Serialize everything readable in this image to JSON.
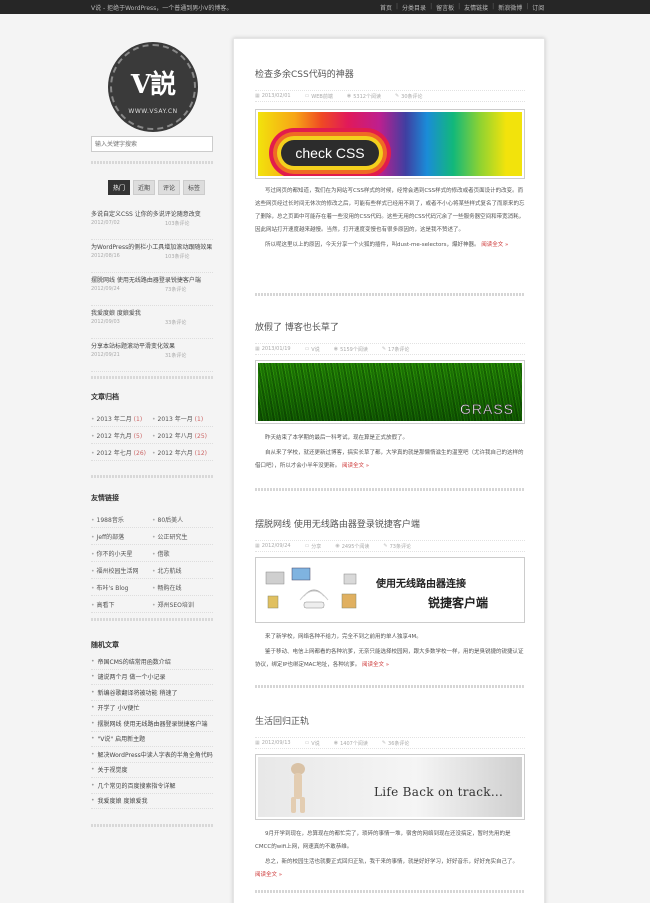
{
  "topbar": {
    "tagline": "V说 - 拒绝于WordPress，一个普通到男小V的博客。",
    "nav": [
      "首页",
      "分类目录",
      "留言板",
      "友情链接",
      "新浪微博",
      "订阅"
    ]
  },
  "logo": {
    "mark": "V説",
    "url": "WWW.VSAY.CN"
  },
  "search": {
    "placeholder": "输入关键字搜索"
  },
  "tabs": [
    "热门",
    "近期",
    "评论",
    "标签"
  ],
  "hot": [
    {
      "title": "多说自定义CSS 让你的多说评论随意改变",
      "date": "2012/07/02",
      "comments": "103条评论"
    },
    {
      "title": "为WordPress的侧栏小工具增加滚动跟随效果",
      "date": "2012/08/16",
      "comments": "103条评论"
    },
    {
      "title": "摆脱网线 使用无线路由器登录锐捷客户端",
      "date": "2012/09/24",
      "comments": "73条评论"
    },
    {
      "title": "我爱度娘 度娘爱我",
      "date": "2012/09/03",
      "comments": "33条评论"
    },
    {
      "title": "分享本站标题滚动平滑变化效果",
      "date": "2012/09/21",
      "comments": "31条评论"
    }
  ],
  "archive": {
    "title": "文章归档",
    "rows": [
      [
        {
          "label": "2013 年二月",
          "count": "(1)"
        },
        {
          "label": "2013 年一月",
          "count": "(1)"
        }
      ],
      [
        {
          "label": "2012 年九月",
          "count": "(5)"
        },
        {
          "label": "2012 年八月",
          "count": "(25)"
        }
      ],
      [
        {
          "label": "2012 年七月",
          "count": "(26)"
        },
        {
          "label": "2012 年六月",
          "count": "(12)"
        }
      ]
    ]
  },
  "links": {
    "title": "友情链接",
    "rows": [
      [
        "1988音乐",
        "80后美人"
      ],
      [
        "Jeff的部落",
        "公正研究生"
      ],
      [
        "你不的小天星",
        "借歌"
      ],
      [
        "福州校园生活网",
        "北方航线"
      ],
      [
        "布咔's Blog",
        "畅购在线"
      ],
      [
        "高看下",
        "郑州SEO培训"
      ]
    ]
  },
  "random": {
    "title": "随机文章",
    "items": [
      "帝国CMS的结常用函数介绍",
      "谴说两个月 做一个小记录",
      "新编谷歌翻译将被功能 稍速了",
      "开学了 小V便忙",
      "摆脱网线 使用无线路由器登录锐捷客户端",
      "\"V说\" 启用新主题",
      "解决WordPress中读人字表的半角全角代码",
      "关于视觉度",
      "几个常见的百度搜索指令详解",
      "我爱度娘 度娘爱我"
    ]
  },
  "posts": [
    {
      "title": "检查多余CSS代码的神器",
      "date": "2013/02/01",
      "category": "WEB前端",
      "views": "5312个阅读",
      "comments": "30条评论",
      "banner_text": "check CSS",
      "paragraphs": [
        "写过网页的都知道，我们在为网站写CSS样式的时候，经常会遇到CSS样式的修改或者页面设计的改变。而这些网页经过长时间无休次的修改之后，可能有些样式已经用不到了，或者不小心将某些样式复名了而原来的忘了删除，总之页面中可能存在着一些没用的CSS代码。这些无用的CSS代码冗余了一些服务器空间和带宽消耗，因此网站打开速度越来越慢。当然，打开速度变慢也有很多原因的，这是我不赞述了。",
        "所以呢这里以上的原因，今天分享一个火狐的插件，叫dust-me-selectors，爆好神器。"
      ],
      "more": "阅读全文 »"
    },
    {
      "title": "放假了 博客也长草了",
      "date": "2013/01/19",
      "category": "V说",
      "views": "5159个阅读",
      "comments": "17条评论",
      "banner_text": "GRASS",
      "paragraphs": [
        "昨天结束了本学期的最后一科考试，现在算是正式放假了。",
        "自从来了学校，就还更新过博客，搞实长草了都，大学真的就是那懒惰滋生的温室吧（尤许我自己的这样的借口吧），所以才会小半年没更新。"
      ],
      "more": "阅读全文 »"
    },
    {
      "title": "摆脱网线 使用无线路由器登录锐捷客户端",
      "date": "2012/09/24",
      "category": "分享",
      "views": "2495个阅读",
      "comments": "73条评论",
      "banner_line1": "使用无线路由器连接",
      "banner_line2": "锐捷客户端",
      "paragraphs": [
        "来了新学校，网络各种不给力，完全不到之前用的单人独享4M。",
        "鉴于移动、电信上网都看的各种坑爹，无奈只能选择校园网，跟大多数学校一样，用的是臭锐捷的锐捷认证协议，绑定IP也绑定MAC地址，各种坑爹。"
      ],
      "more": "阅读全文 »"
    },
    {
      "title": "生活回归正轨",
      "date": "2012/09/13",
      "category": "V说",
      "views": "1407个阅读",
      "comments": "36条评论",
      "banner_text": "Life Back on track...",
      "paragraphs": [
        "9月开学到现在，总算现在的都忙完了，琐碎的事情一堆，宿舍的网络到现在还没搞定，暂时先用的是CMCC的wifi上网，网速真的不敢恭维。",
        "总之，新的校园生活也就要正式回归正轨，我干来的事情，就是好好学习，好好音乐，好好充实自己了。"
      ],
      "more": "阅读全文 »"
    }
  ]
}
